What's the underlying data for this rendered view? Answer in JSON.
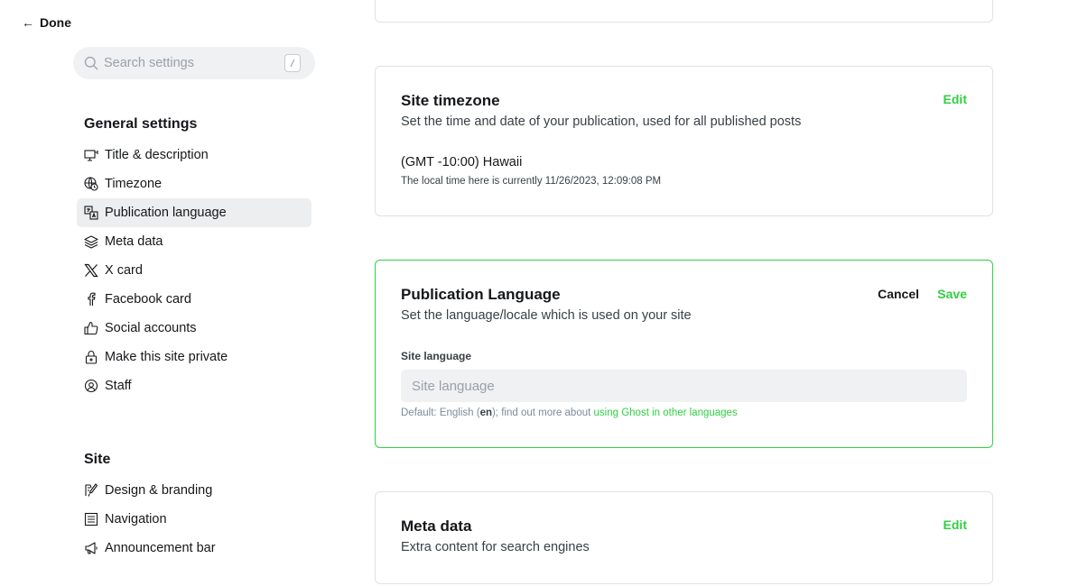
{
  "header": {
    "done_label": "Done"
  },
  "search": {
    "placeholder": "Search settings",
    "shortcut": "/"
  },
  "sidebar": {
    "general_heading": "General settings",
    "general_items": [
      {
        "label": "Title & description",
        "icon": "presentation-icon"
      },
      {
        "label": "Timezone",
        "icon": "globe-clock-icon"
      },
      {
        "label": "Publication language",
        "icon": "translate-icon"
      },
      {
        "label": "Meta data",
        "icon": "layers-icon"
      },
      {
        "label": "X card",
        "icon": "x-logo-icon"
      },
      {
        "label": "Facebook card",
        "icon": "facebook-icon"
      },
      {
        "label": "Social accounts",
        "icon": "thumbs-up-icon"
      },
      {
        "label": "Make this site private",
        "icon": "lock-icon"
      },
      {
        "label": "Staff",
        "icon": "staff-icon"
      }
    ],
    "active_item": "Publication language",
    "site_heading": "Site",
    "site_items": [
      {
        "label": "Design & branding",
        "icon": "paint-brush-icon"
      },
      {
        "label": "Navigation",
        "icon": "list-icon"
      },
      {
        "label": "Announcement bar",
        "icon": "megaphone-icon"
      }
    ]
  },
  "timezone_card": {
    "title": "Site timezone",
    "description": "Set the time and date of your publication, used for all published posts",
    "edit_label": "Edit",
    "value": "(GMT -10:00) Hawaii",
    "local_time": "The local time here is currently 11/26/2023, 12:09:08 PM"
  },
  "language_card": {
    "title": "Publication Language",
    "description": "Set the language/locale which is used on your site",
    "cancel_label": "Cancel",
    "save_label": "Save",
    "field_label": "Site language",
    "field_placeholder": "Site language",
    "field_value": "",
    "hint_prefix": "Default: English (",
    "hint_code": "en",
    "hint_middle": "); find out more about ",
    "hint_link": "using Ghost in other languages"
  },
  "meta_card": {
    "title": "Meta data",
    "description": "Extra content for search engines",
    "edit_label": "Edit"
  },
  "colors": {
    "accent": "#30cf43",
    "text": "#15171a",
    "muted": "#7c8b9a",
    "active_bg": "#eceef0"
  }
}
